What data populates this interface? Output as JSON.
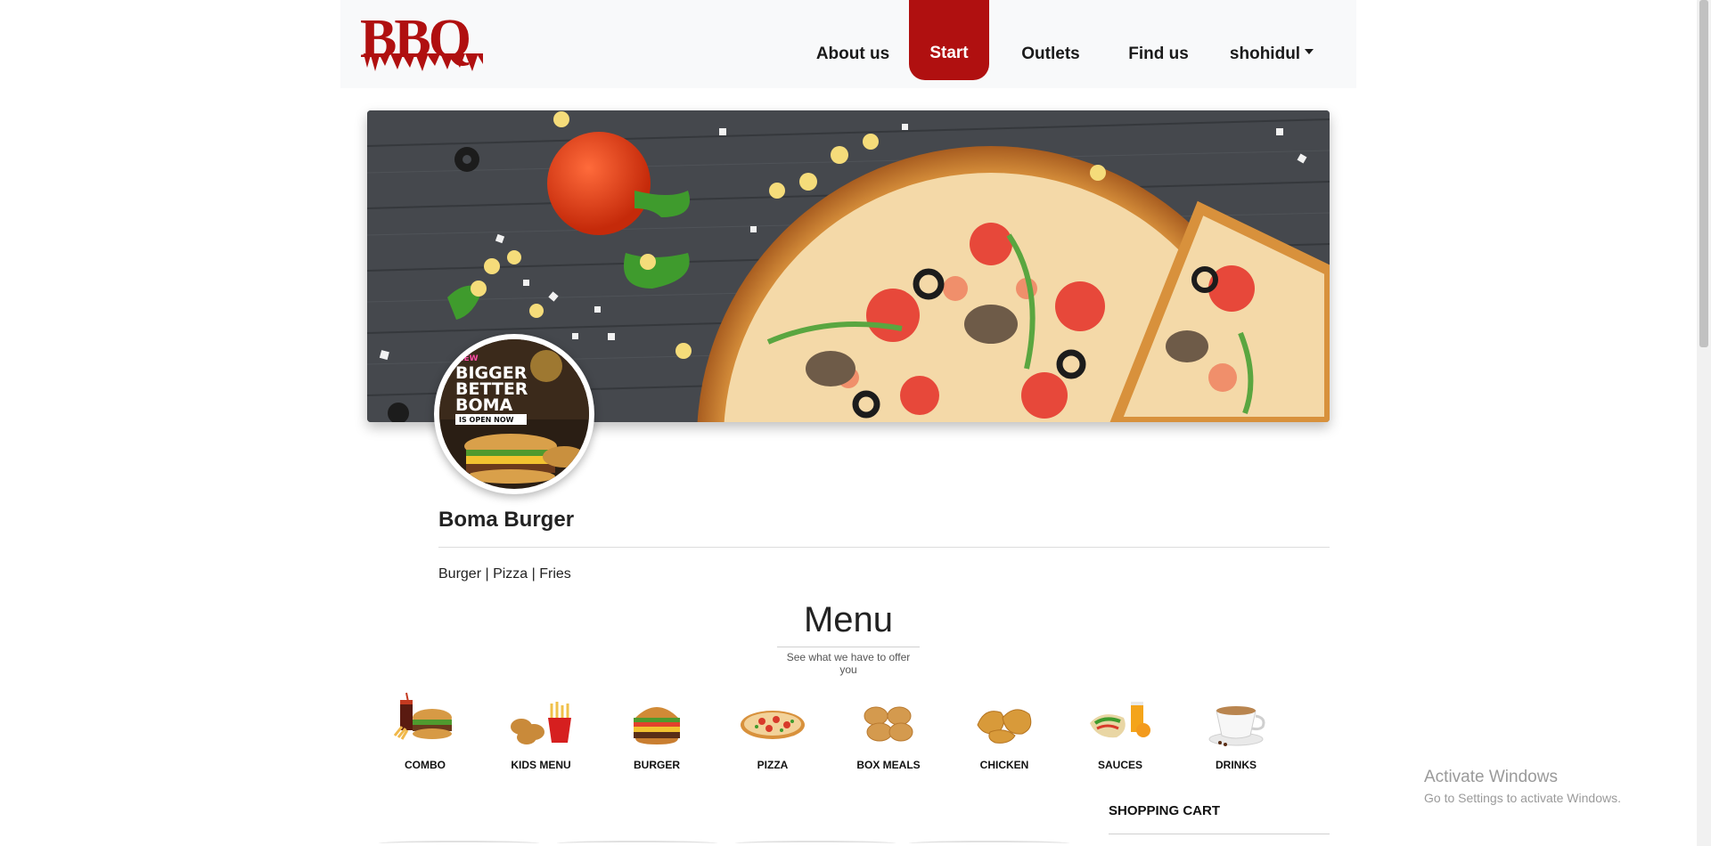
{
  "navbar": {
    "logo_text": "BBQ",
    "items": [
      {
        "label": "About us"
      },
      {
        "label": "Start",
        "active": true
      },
      {
        "label": "Outlets"
      },
      {
        "label": "Find us"
      }
    ],
    "user_label": "shohidul"
  },
  "restaurant": {
    "name": "Boma Burger",
    "tags": "Burger | Pizza | Fries",
    "avatar_text": [
      "NEW",
      "BIGGER",
      "BETTER",
      "BOMA",
      "IS OPEN NOW"
    ]
  },
  "menu": {
    "title": "Menu",
    "subtitle": "See what we have to offer you",
    "categories": [
      {
        "label": "COMBO",
        "icon": "combo-icon"
      },
      {
        "label": "KIDS MENU",
        "icon": "kids-menu-icon"
      },
      {
        "label": "BURGER",
        "icon": "burger-icon"
      },
      {
        "label": "PIZZA",
        "icon": "pizza-icon"
      },
      {
        "label": "BOX MEALS",
        "icon": "box-meals-icon"
      },
      {
        "label": "CHICKEN",
        "icon": "chicken-icon"
      },
      {
        "label": "SAUCES",
        "icon": "sauces-icon"
      },
      {
        "label": "DRINKS",
        "icon": "drinks-icon"
      }
    ]
  },
  "cart": {
    "title": "SHOPPING CART"
  },
  "watermark": {
    "line1": "Activate Windows",
    "line2": "Go to Settings to activate Windows."
  },
  "colors": {
    "brand_red": "#b01010",
    "navbar_bg": "#f8f9fa",
    "banner_wood": "#3f4247"
  }
}
